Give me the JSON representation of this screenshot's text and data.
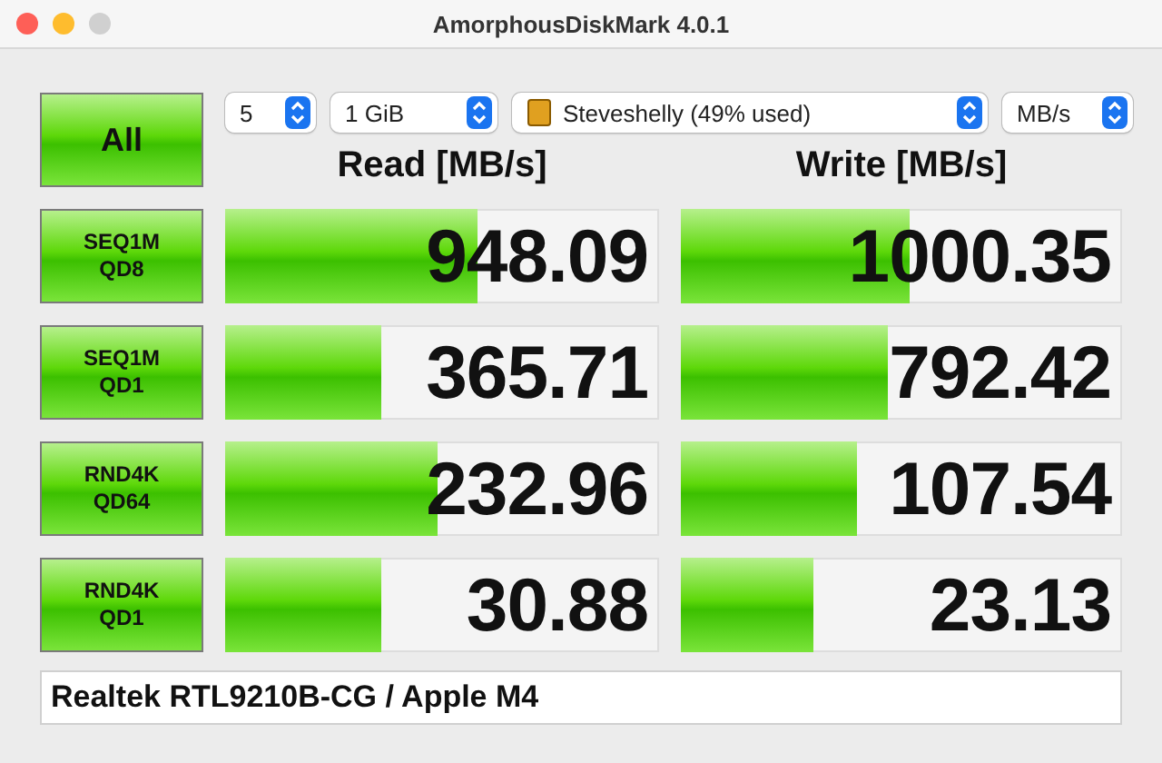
{
  "window": {
    "title": "AmorphousDiskMark 4.0.1"
  },
  "controls": {
    "all_button": "All",
    "count": "5",
    "size": "1 GiB",
    "drive": "Steveshelly (49% used)",
    "unit": "MB/s"
  },
  "headers": {
    "read": "Read [MB/s]",
    "write": "Write [MB/s]"
  },
  "tests": [
    {
      "label_1": "SEQ1M",
      "label_2": "QD8",
      "read": {
        "value": "948.09",
        "level": 0.58
      },
      "write": {
        "value": "1000.35",
        "level": 0.52
      }
    },
    {
      "label_1": "SEQ1M",
      "label_2": "QD1",
      "read": {
        "value": "365.71",
        "level": 0.36
      },
      "write": {
        "value": "792.42",
        "level": 0.47
      }
    },
    {
      "label_1": "RND4K",
      "label_2": "QD64",
      "read": {
        "value": "232.96",
        "level": 0.49
      },
      "write": {
        "value": "107.54",
        "level": 0.4
      }
    },
    {
      "label_1": "RND4K",
      "label_2": "QD1",
      "read": {
        "value": "30.88",
        "level": 0.36
      },
      "write": {
        "value": "23.13",
        "level": 0.3
      }
    }
  ],
  "comment": "Realtek RTL9210B-CG / Apple M4"
}
